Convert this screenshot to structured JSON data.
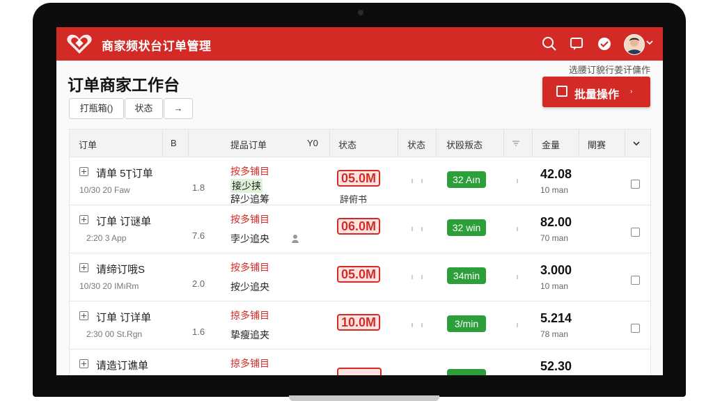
{
  "header": {
    "app_title": "商家频状台订单管理",
    "accent_color": "#d42a26",
    "icons": [
      "search-icon",
      "chat-icon",
      "verified-badge-icon",
      "avatar",
      "chevron-down-icon"
    ]
  },
  "page": {
    "title": "订单商家工作台",
    "hint": "选腰订貌行姜讦傭作",
    "bulk_button": "批量操作",
    "filters": [
      "打瓶箱()",
      "状态",
      "→"
    ]
  },
  "table": {
    "headers": [
      "订单",
      "B",
      "提品订单",
      "Y0",
      "状态",
      "状态",
      "状殴叛态",
      "金量",
      "閘赛"
    ],
    "rows": [
      {
        "title": "请单 5Ţ订单",
        "sub": "10/30 20 Faw",
        "b": "1.8",
        "p1": "按多铺目",
        "p2": "接少挟",
        "p3": "辞少追筹",
        "amount": "05.0M",
        "status_sub": "辞俯书",
        "time": "32 Aın",
        "qty": "42.08",
        "unit": "10 man"
      },
      {
        "title": "订单 订谜单",
        "sub": "2:20 3 App",
        "b": "7.6",
        "p1": "按多铺目",
        "p2": "",
        "p3": "孛少追央",
        "amount": "06.0M",
        "status_sub": "",
        "time": "32 win",
        "qty": "82.00",
        "unit": "70 man"
      },
      {
        "title": "请缔订哦S",
        "sub": "10/30 20 IMıRm",
        "b": "2.0",
        "p1": "按多铺目",
        "p2": "",
        "p3": "按少追央",
        "amount": "05.0M",
        "status_sub": "",
        "time": "34min",
        "qty": "3.000",
        "unit": "10 man"
      },
      {
        "title": "订单 订详单",
        "sub": "2:30 00 St.Rgn",
        "b": "1.6",
        "p1": "掠多铺目",
        "p2": "",
        "p3": "挚瘦追夹",
        "amount": "10.0M",
        "status_sub": "",
        "time": "3/min",
        "qty": "5.214",
        "unit": "78 man"
      },
      {
        "title": "请造订谯单",
        "sub": "",
        "b": "",
        "p1": "掠多铺目",
        "p2": "",
        "p3": "",
        "amount": "",
        "status_sub": "",
        "time": "",
        "qty": "52.30",
        "unit": ""
      }
    ]
  }
}
